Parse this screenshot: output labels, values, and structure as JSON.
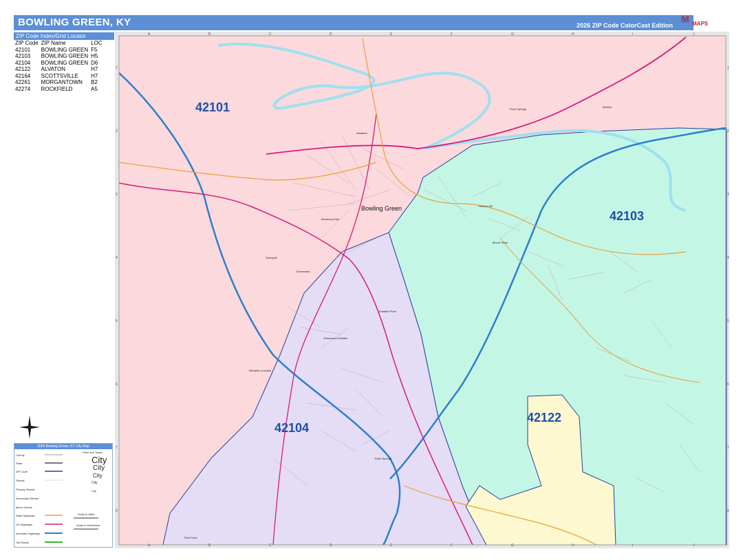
{
  "header": {
    "title": "BOWLING GREEN, KY",
    "edition": "2026 ZIP Code ColorCast Edition",
    "logo_m": "M",
    "logo_maps": "MAPS",
    "logo_tag": "arket"
  },
  "index": {
    "heading": "ZIP Code Index/Grid Locator",
    "columns": [
      "ZIP Code",
      "ZIP Name",
      "LOC"
    ],
    "rows": [
      [
        "42101",
        "BOWLING GREEN",
        "F5"
      ],
      [
        "42103",
        "BOWLING GREEN",
        "H5"
      ],
      [
        "42104",
        "BOWLING GREEN",
        "D6"
      ],
      [
        "42122",
        "ALVATON",
        "H7"
      ],
      [
        "42164",
        "SCOTTSVILLE",
        "H7"
      ],
      [
        "42261",
        "MORGANTOWN",
        "B2"
      ],
      [
        "42274",
        "ROCKFIELD",
        "A5"
      ]
    ]
  },
  "grid": {
    "columns": [
      "A",
      "B",
      "C",
      "D",
      "E",
      "F",
      "G",
      "H",
      "I",
      "J"
    ],
    "rows": [
      "1",
      "2",
      "3",
      "4",
      "5",
      "6",
      "7",
      "8"
    ]
  },
  "map": {
    "zips": [
      {
        "code": "42101"
      },
      {
        "code": "42103"
      },
      {
        "code": "42104"
      },
      {
        "code": "42122"
      }
    ],
    "main_city": "Bowling Green",
    "places": [
      "Plum Springs",
      "Bristow",
      "Delafield",
      "Hoover Hill",
      "Crossroads",
      "Springhill",
      "Mount Victor",
      "Eastland Park",
      "Greenwood Estates",
      "Memphis Junction",
      "Three Springs",
      "Rich Pond",
      "Browning Park"
    ],
    "colors": {
      "zip_42101": "#fbd9dc",
      "zip_42103": "#c4f6e6",
      "zip_42104": "#e5dcf6",
      "zip_42122": "#fdf8cf",
      "interstate": "#2c7fc9",
      "us_highway": "#d81b7a",
      "state_highway": "#e8a038",
      "water": "#9fe0ef",
      "zip_boundary": "#2a3f9c"
    }
  },
  "legend": {
    "title": "2026 Bowling Green, KY City Map",
    "items": [
      "County",
      "State",
      "ZIP Code",
      "Streets",
      "Primary Streets",
      "Secondary Streets",
      "Minor Streets",
      "State Highways",
      "US Highways",
      "Interstate Highways",
      "Toll Roads"
    ],
    "cities_heading": "Cities and Towns",
    "city_label": "City",
    "scale_miles": "Scale in Miles",
    "scale_km": "Scale in Kilometers"
  }
}
